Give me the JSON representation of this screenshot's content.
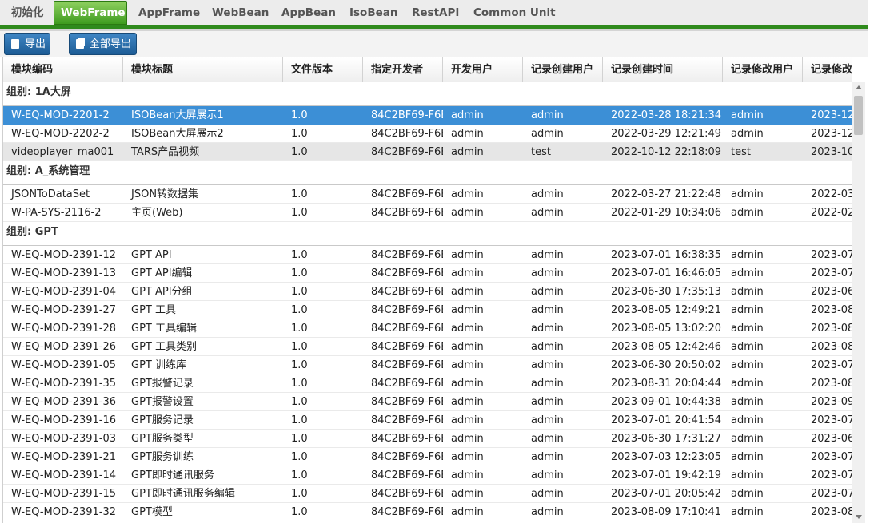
{
  "tabs": [
    {
      "label": "初始化"
    },
    {
      "label": "WebFrame"
    },
    {
      "label": "AppFrame"
    },
    {
      "label": "WebBean"
    },
    {
      "label": "AppBean"
    },
    {
      "label": "IsoBean"
    },
    {
      "label": "RestAPI"
    },
    {
      "label": "Common Unit"
    }
  ],
  "active_tab": "WebFrame",
  "toolbar": {
    "export_label": "导出",
    "export_all_label": "全部导出"
  },
  "columns": [
    {
      "label": "模块编码"
    },
    {
      "label": "模块标题"
    },
    {
      "label": "文件版本"
    },
    {
      "label": "指定开发者"
    },
    {
      "label": "开发用户"
    },
    {
      "label": "记录创建用户"
    },
    {
      "label": "记录创建时间"
    },
    {
      "label": "记录修改用户"
    },
    {
      "label": "记录修改时间"
    }
  ],
  "groups": [
    {
      "label": "组别: 1A大屏",
      "rows": [
        {
          "code": "W-EQ-MOD-2201-2",
          "title": "ISOBean大屏展示1",
          "version": "1.0",
          "developer": "84C2BF69-F6B",
          "dev_user": "admin",
          "creator": "admin",
          "created": "2022-03-28 18:21:34",
          "modifier": "admin",
          "modified": "2023-12-",
          "selected": true
        },
        {
          "code": "W-EQ-MOD-2202-2",
          "title": "ISOBean大屏展示2",
          "version": "1.0",
          "developer": "84C2BF69-F6B",
          "dev_user": "admin",
          "creator": "admin",
          "created": "2022-03-29 12:21:49",
          "modifier": "admin",
          "modified": "2023-12-"
        },
        {
          "code": "videoplayer_ma001",
          "title": "TARS产品视频",
          "version": "1.0",
          "developer": "84C2BF69-F6B",
          "dev_user": "admin",
          "creator": "test",
          "created": "2022-10-12 22:18:09",
          "modifier": "test",
          "modified": "2023-10-",
          "hover": true
        }
      ]
    },
    {
      "label": "组别: A_系统管理",
      "rows": [
        {
          "code": "JSONToDataSet",
          "title": "JSON转数据集",
          "version": "1.0",
          "developer": "84C2BF69-F6B",
          "dev_user": "admin",
          "creator": "admin",
          "created": "2022-03-27 21:22:48",
          "modifier": "admin",
          "modified": "2022-03-"
        },
        {
          "code": "W-PA-SYS-2116-2",
          "title": "主页(Web)",
          "version": "1.0",
          "developer": "84C2BF69-F6B",
          "dev_user": "admin",
          "creator": "admin",
          "created": "2022-01-29 10:34:06",
          "modifier": "admin",
          "modified": "2022-02-"
        }
      ]
    },
    {
      "label": "组别: GPT",
      "rows": [
        {
          "code": "W-EQ-MOD-2391-12",
          "title": "GPT API",
          "version": "1.0",
          "developer": "84C2BF69-F6B",
          "dev_user": "admin",
          "creator": "admin",
          "created": "2023-07-01 16:38:35",
          "modifier": "admin",
          "modified": "2023-07-"
        },
        {
          "code": "W-EQ-MOD-2391-13",
          "title": "GPT API编辑",
          "version": "1.0",
          "developer": "84C2BF69-F6B",
          "dev_user": "admin",
          "creator": "admin",
          "created": "2023-07-01 16:46:05",
          "modifier": "admin",
          "modified": "2023-07-"
        },
        {
          "code": "W-EQ-MOD-2391-04",
          "title": "GPT API分组",
          "version": "1.0",
          "developer": "84C2BF69-F6B",
          "dev_user": "admin",
          "creator": "admin",
          "created": "2023-06-30 17:35:13",
          "modifier": "admin",
          "modified": "2023-06-"
        },
        {
          "code": "W-EQ-MOD-2391-27",
          "title": "GPT 工具",
          "version": "1.0",
          "developer": "84C2BF69-F6B",
          "dev_user": "admin",
          "creator": "admin",
          "created": "2023-08-05 12:49:21",
          "modifier": "admin",
          "modified": "2023-08-"
        },
        {
          "code": "W-EQ-MOD-2391-28",
          "title": "GPT 工具编辑",
          "version": "1.0",
          "developer": "84C2BF69-F6B",
          "dev_user": "admin",
          "creator": "admin",
          "created": "2023-08-05 13:02:20",
          "modifier": "admin",
          "modified": "2023-08-"
        },
        {
          "code": "W-EQ-MOD-2391-26",
          "title": "GPT 工具类别",
          "version": "1.0",
          "developer": "84C2BF69-F6B",
          "dev_user": "admin",
          "creator": "admin",
          "created": "2023-08-05 12:42:46",
          "modifier": "admin",
          "modified": "2023-08-"
        },
        {
          "code": "W-EQ-MOD-2391-05",
          "title": "GPT 训练库",
          "version": "1.0",
          "developer": "84C2BF69-F6B",
          "dev_user": "admin",
          "creator": "admin",
          "created": "2023-06-30 20:50:02",
          "modifier": "admin",
          "modified": "2023-07-"
        },
        {
          "code": "W-EQ-MOD-2391-35",
          "title": "GPT报警记录",
          "version": "1.0",
          "developer": "84C2BF69-F6B",
          "dev_user": "admin",
          "creator": "admin",
          "created": "2023-08-31 20:04:44",
          "modifier": "admin",
          "modified": "2023-08-"
        },
        {
          "code": "W-EQ-MOD-2391-36",
          "title": "GPT报警设置",
          "version": "1.0",
          "developer": "84C2BF69-F6B",
          "dev_user": "admin",
          "creator": "admin",
          "created": "2023-09-01 10:44:38",
          "modifier": "admin",
          "modified": "2023-09-"
        },
        {
          "code": "W-EQ-MOD-2391-16",
          "title": "GPT服务记录",
          "version": "1.0",
          "developer": "84C2BF69-F6B",
          "dev_user": "admin",
          "creator": "admin",
          "created": "2023-07-01 20:41:54",
          "modifier": "admin",
          "modified": "2023-07-"
        },
        {
          "code": "W-EQ-MOD-2391-03",
          "title": "GPT服务类型",
          "version": "1.0",
          "developer": "84C2BF69-F6B",
          "dev_user": "admin",
          "creator": "admin",
          "created": "2023-06-30 17:31:27",
          "modifier": "admin",
          "modified": "2023-06-"
        },
        {
          "code": "W-EQ-MOD-2391-21",
          "title": "GPT服务训练",
          "version": "1.0",
          "developer": "84C2BF69-F6B",
          "dev_user": "admin",
          "creator": "admin",
          "created": "2023-07-03 12:23:05",
          "modifier": "admin",
          "modified": "2023-07-"
        },
        {
          "code": "W-EQ-MOD-2391-14",
          "title": "GPT即时通讯服务",
          "version": "1.0",
          "developer": "84C2BF69-F6B",
          "dev_user": "admin",
          "creator": "admin",
          "created": "2023-07-01 19:42:19",
          "modifier": "admin",
          "modified": "2023-07-"
        },
        {
          "code": "W-EQ-MOD-2391-15",
          "title": "GPT即时通讯服务编辑",
          "version": "1.0",
          "developer": "84C2BF69-F6B",
          "dev_user": "admin",
          "creator": "admin",
          "created": "2023-07-01 20:05:42",
          "modifier": "admin",
          "modified": "2023-07-"
        },
        {
          "code": "W-EQ-MOD-2391-32",
          "title": "GPT模型",
          "version": "1.0",
          "developer": "84C2BF69-F6B",
          "dev_user": "admin",
          "creator": "admin",
          "created": "2023-08-09 17:10:41",
          "modifier": "admin",
          "modified": "2023-08-"
        }
      ]
    }
  ],
  "colors": {
    "active_tab": "#3e9b1f",
    "selected_row": "#3c8fd6",
    "button": "#1d5c95"
  }
}
